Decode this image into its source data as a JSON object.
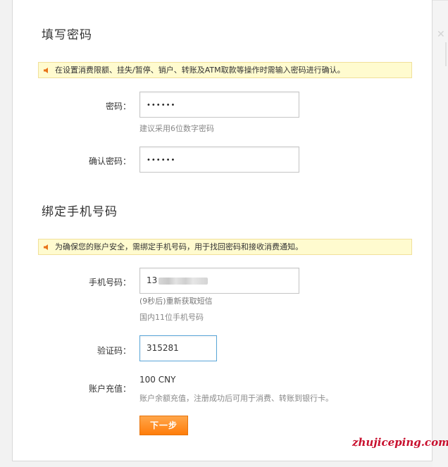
{
  "password_section": {
    "title": "填写密码",
    "tip": "在设置消费限额、挂失/暂停、销户、转账及ATM取款等操作时需输入密码进行确认。",
    "password_label": "密码：",
    "password_value": "••••••",
    "password_hint": "建议采用6位数字密码",
    "confirm_label": "确认密码：",
    "confirm_value": "••••••"
  },
  "phone_section": {
    "title": "绑定手机号码",
    "tip": "为确保您的账户安全，需绑定手机号码，用于找回密码和接收消费通知。",
    "phone_label": "手机号码：",
    "phone_prefix": "13",
    "resend_text": "(9秒后)重新获取短信",
    "phone_hint": "国内11位手机号码",
    "code_label": "验证码：",
    "code_value": "315281",
    "recharge_label": "账户充值：",
    "recharge_amount": "100 CNY",
    "recharge_hint": "账户余额充值，注册成功后可用于消费、转账到银行卡。"
  },
  "next_button_label": "下一步",
  "watermark": "zhujiceping.com",
  "icons": {
    "tip": "speaker-icon",
    "close": "close-icon"
  },
  "colors": {
    "accent_orange": "#ff8a1f",
    "tip_background": "#fffbcf",
    "active_border": "#5aa6d8",
    "watermark": "#c8102e"
  }
}
